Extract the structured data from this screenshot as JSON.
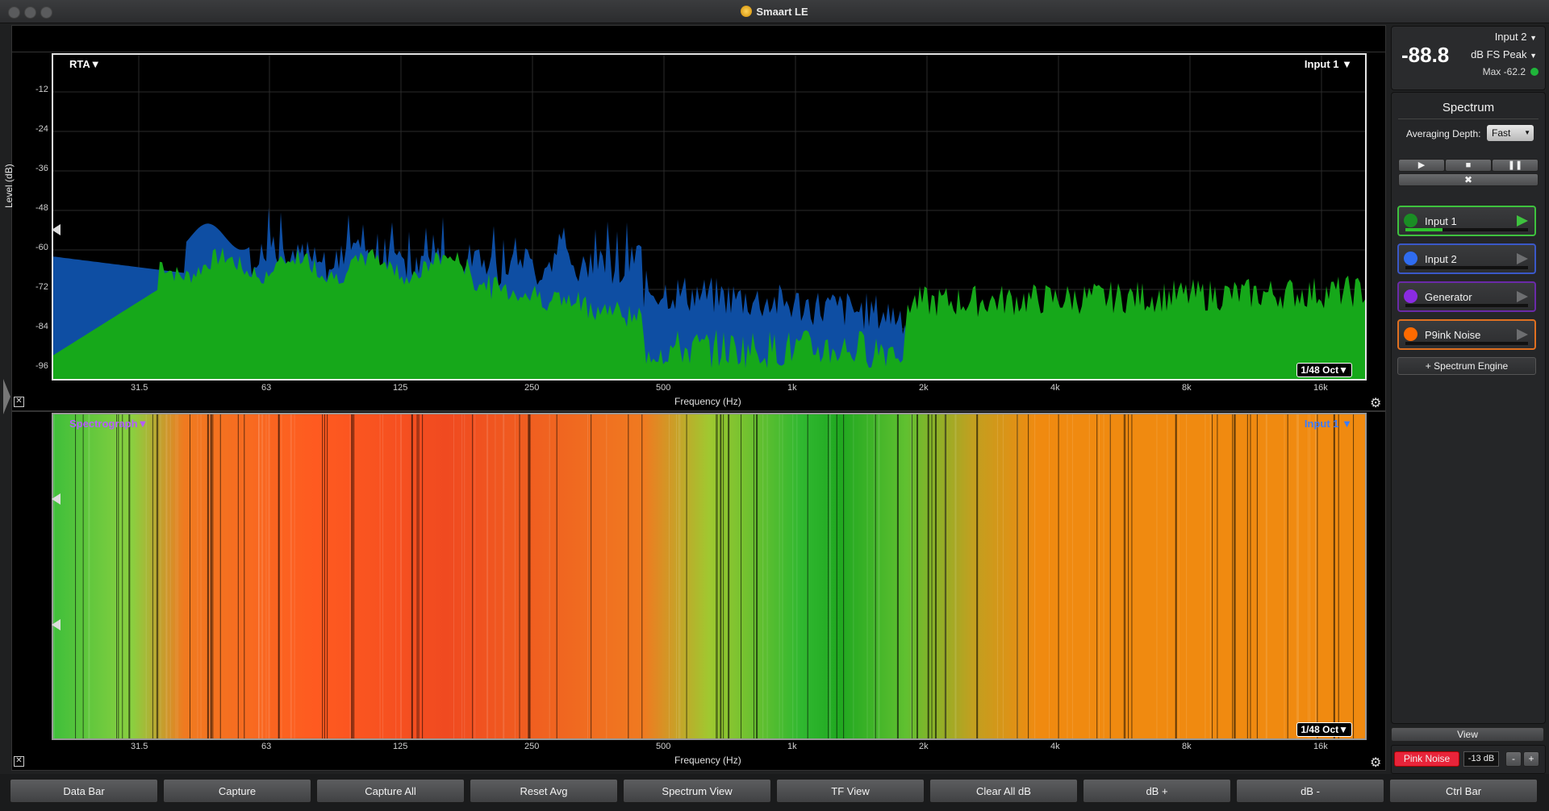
{
  "window": {
    "title": "Smaart LE"
  },
  "rta": {
    "mode_label": "RTA▼",
    "input_label": "Input 1 ▼",
    "resolution_label": "1/48 Oct▼",
    "ylabel": "Level (dB)",
    "xlabel": "Frequency (Hz)",
    "yticks": [
      "-12",
      "-24",
      "-36",
      "-48",
      "-60",
      "-72",
      "-84",
      "-96"
    ],
    "xticks": [
      "31.5",
      "63",
      "125",
      "250",
      "500",
      "1k",
      "2k",
      "4k",
      "8k",
      "16k"
    ]
  },
  "spectrograph": {
    "mode_label": "Spectrograph▼",
    "input_label": "Input 1 ▼",
    "resolution_label": "1/48 Oct▼",
    "xlabel": "Frequency (Hz)",
    "xticks": [
      "31.5",
      "63",
      "125",
      "250",
      "500",
      "1k",
      "2k",
      "4k",
      "8k",
      "16k"
    ]
  },
  "meter": {
    "value": "-88.8",
    "input_select": "Input 2",
    "unit_select": "dB FS Peak",
    "max_label": "Max -62.2",
    "max_indicator_color": "#1fb53a"
  },
  "spectrum_panel": {
    "title": "Spectrum",
    "averaging_label": "Averaging Depth:",
    "averaging_value": "Fast",
    "inputs": [
      {
        "name": "Input 1",
        "color": "#1a8d24",
        "border": "#3ec23e",
        "level": 0.3
      },
      {
        "name": "Input 2",
        "color": "#2f6cf0",
        "border": "#3a58c8",
        "level": 0
      },
      {
        "name": "Generator",
        "color": "#8a2be2",
        "border": "#6a2aa8",
        "level": 0
      },
      {
        "name": "P9ink Noise",
        "color": "#ff6a00",
        "border": "#e07020",
        "level": 0
      }
    ],
    "add_engine_label": "+ Spectrum Engine",
    "view_label": "View",
    "generator_button": "Pink Noise",
    "generator_level": "-13 dB",
    "minus_label": "-",
    "plus_label": "+"
  },
  "bottom_bar": {
    "buttons": [
      "Data Bar",
      "Capture",
      "Capture All",
      "Reset Avg",
      "Spectrum View",
      "TF View",
      "Clear All dB",
      "dB +",
      "dB -",
      "Ctrl Bar"
    ]
  },
  "colors": {
    "rta_blue": "#0e4ea3",
    "rta_green": "#16a81a",
    "accent_red": "#e8243a"
  }
}
